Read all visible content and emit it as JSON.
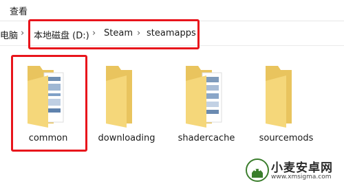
{
  "ribbon": {
    "tab_view": "查看"
  },
  "address": {
    "crumbs": [
      "电脑",
      "本地磁盘 (D:)",
      "Steam",
      "steamapps"
    ]
  },
  "items": [
    {
      "name": "common",
      "type": "folder-with-files"
    },
    {
      "name": "downloading",
      "type": "folder-empty"
    },
    {
      "name": "shadercache",
      "type": "folder-with-files"
    },
    {
      "name": "sourcemods",
      "type": "folder-empty"
    }
  ],
  "watermark": {
    "brand": "小麦安卓网",
    "url": "www.xmsigma.com"
  },
  "colors": {
    "highlight": "#e8141b",
    "folder": "#f5d77a"
  }
}
